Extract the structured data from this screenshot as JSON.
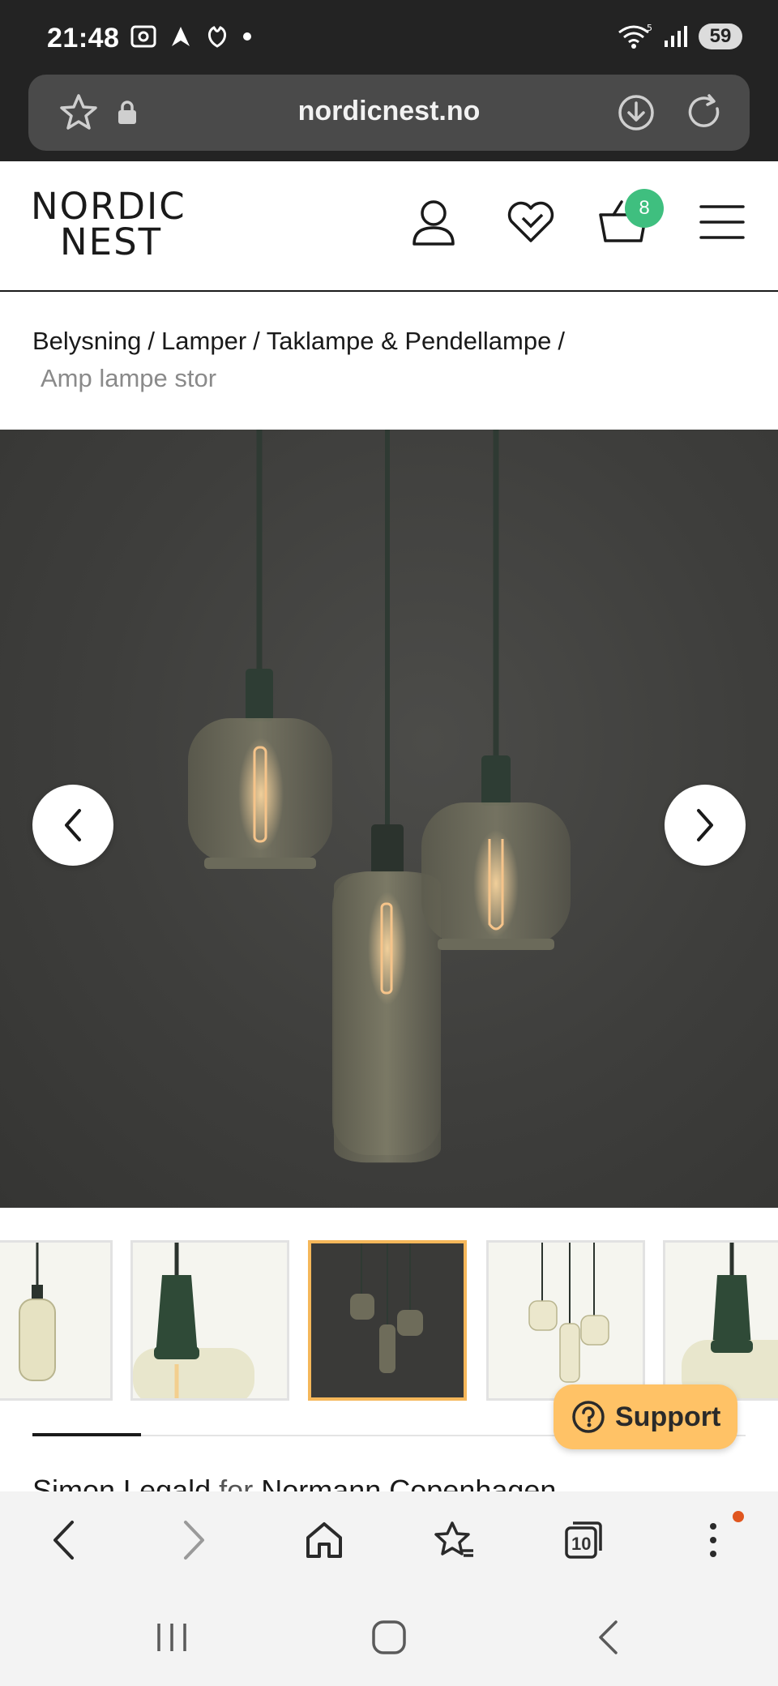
{
  "status_bar": {
    "time": "21:48",
    "battery": "59",
    "network": "5"
  },
  "url_bar": {
    "url": "nordicnest.no"
  },
  "site": {
    "logo_line1": "NORDIC",
    "logo_line2": "NEST",
    "cart_count": "8"
  },
  "breadcrumb": {
    "items": [
      "Belysning",
      "Lamper",
      "Taklampe & Pendellampe"
    ],
    "separator": "/",
    "current": "Amp lampe stor"
  },
  "gallery": {
    "thumbnail_count": 5,
    "active_index": 2
  },
  "support": {
    "label": "Support"
  },
  "designer": {
    "name": "Simon Legald",
    "connector": "for",
    "brand": "Normann Copenhagen"
  },
  "browser_bar": {
    "tab_count": "10"
  },
  "colors": {
    "cart_badge": "#3fbf7f",
    "support_button": "#ffc266",
    "active_thumb_border": "#f5b75a",
    "notification_dot": "#e0561f"
  }
}
